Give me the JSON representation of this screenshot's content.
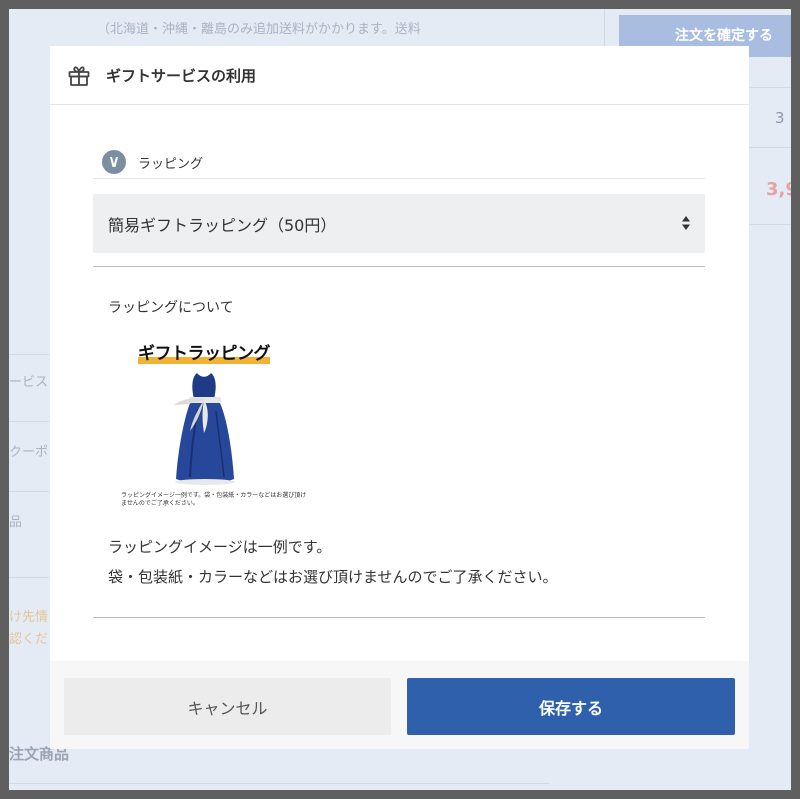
{
  "background": {
    "shipping_note": "（北海道・沖縄・離島のみ追加送料がかかります。送料",
    "confirm_button": "注文を確定する",
    "right_count": "3",
    "right_price": "3,9",
    "left_items": [
      "ービス",
      "クーポ",
      "品"
    ],
    "left_warning": [
      "け先情",
      "認くだ"
    ],
    "order_items_heading": "注文商品"
  },
  "modal": {
    "title": "ギフトサービスの利用",
    "section_label": "ラッピング",
    "select_value": "簡易ギフトラッピング（50円）",
    "about_label": "ラッピングについて",
    "image": {
      "title": "ギフトラッピング",
      "caption": "ラッピングイメージ一例です。袋・包装紙・カラーなどはお選び頂けませんのでご了承ください。"
    },
    "note_line1": "ラッピングイメージは一例です。",
    "note_line2": "袋・包装紙・カラーなどはお選び頂けませんのでご了承ください。",
    "cancel_label": "キャンセル",
    "save_label": "保存する"
  },
  "colors": {
    "primary": "#2e60ac",
    "overlay": "#5f5f5f",
    "wrap_bag": "#24418d",
    "accent_bar": "#f2b233"
  },
  "icons": [
    "gift-icon",
    "wrapping-icon",
    "select-arrows-icon"
  ]
}
